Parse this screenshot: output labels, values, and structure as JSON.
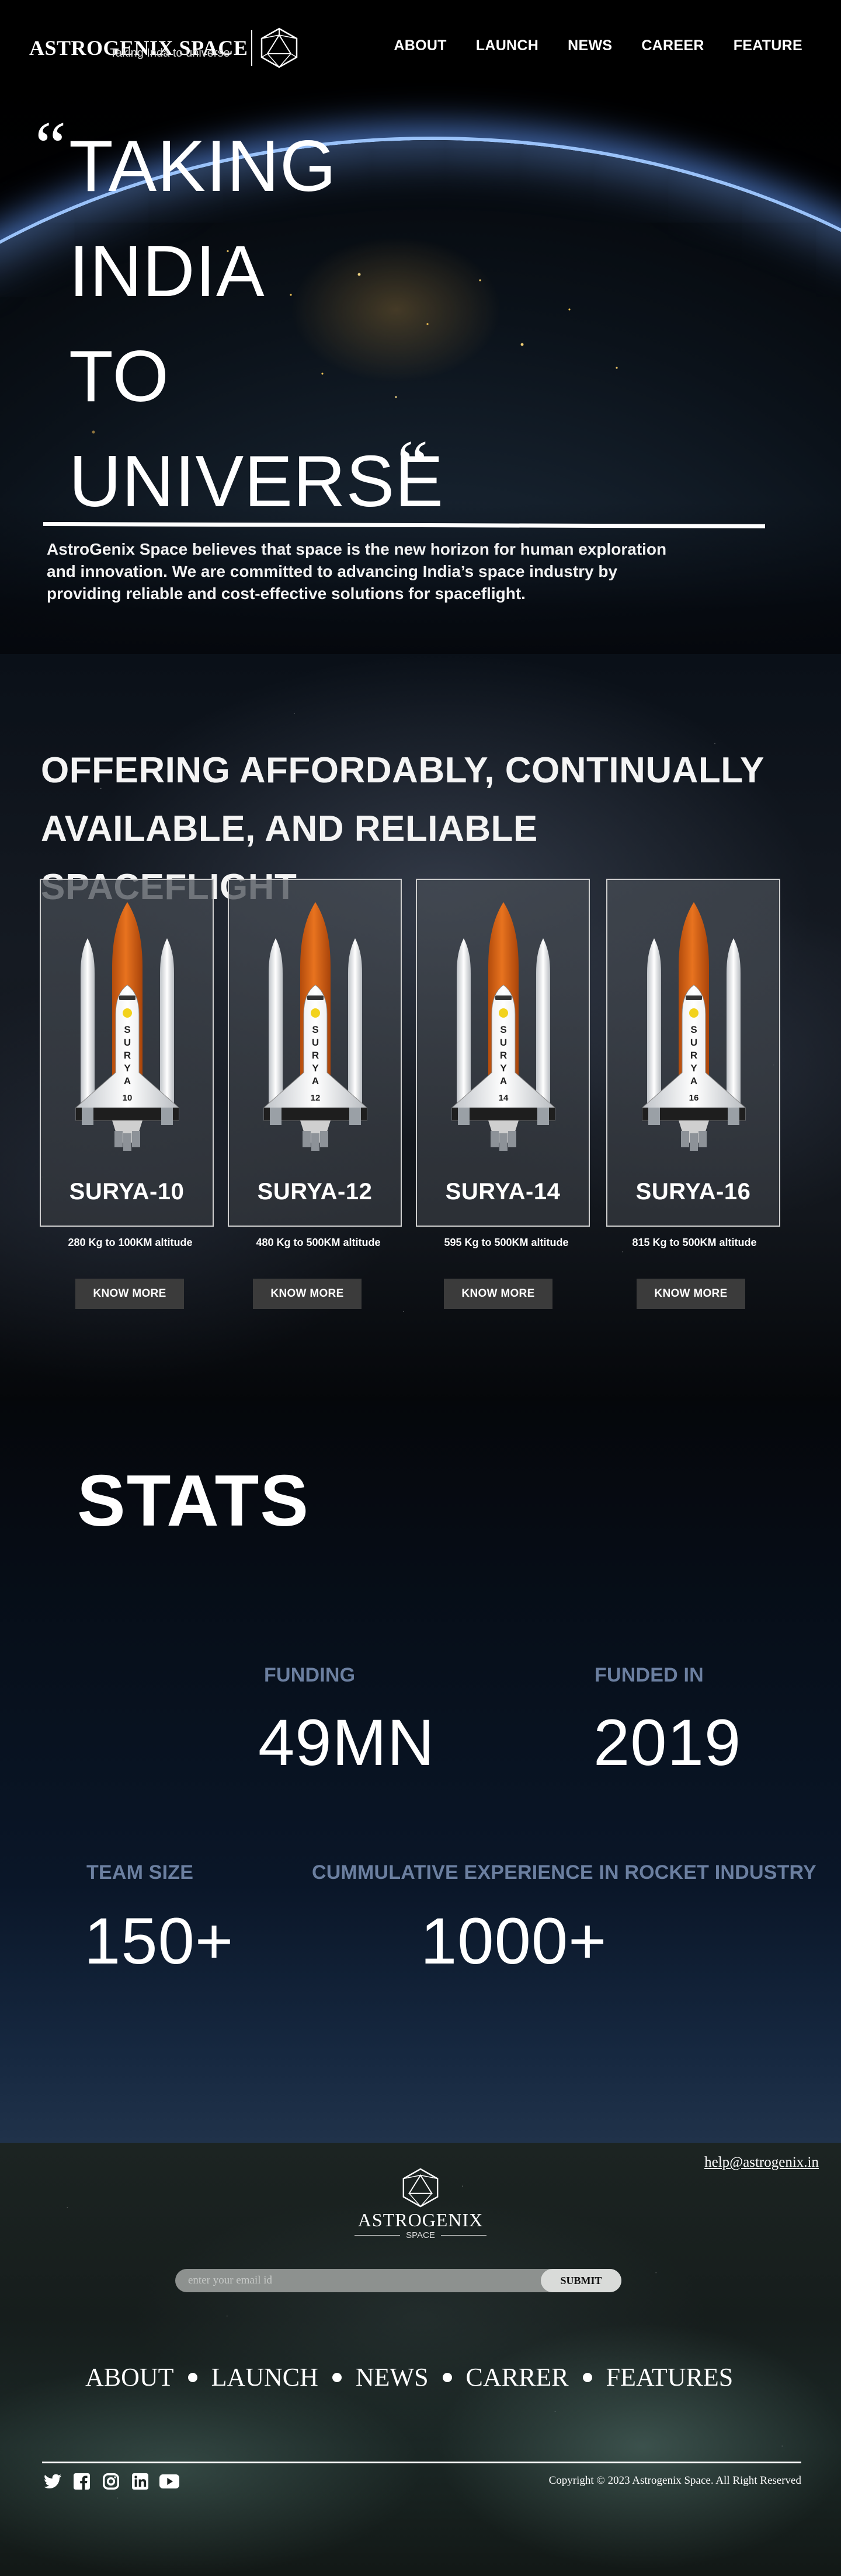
{
  "brand": {
    "name": "ASTROGENIX SPACE",
    "tagline": "Taking Inda to universe"
  },
  "nav": {
    "items": [
      {
        "label": "ABOUT"
      },
      {
        "label": "LAUNCH"
      },
      {
        "label": "NEWS"
      },
      {
        "label": "CAREER"
      },
      {
        "label": "FEATURE"
      }
    ]
  },
  "hero": {
    "quote_open": "“",
    "quote_close": "“",
    "lines": [
      "TAKING",
      "INDIA",
      "TO",
      "UNIVERSE"
    ],
    "description": "AstroGenix Space believes that space is the new horizon for human exploration and innovation. We are committed to advancing India’s space industry by providing reliable and cost-effective solutions for spaceflight."
  },
  "offering": {
    "title_line1": "OFFERING AFFORDABLY, CONTINUALLY",
    "title_line2": "AVAILABLE, AND RELIABLE SPACEFLIGHT",
    "rockets": [
      {
        "name": "SURYA-10",
        "number": "10",
        "spec": "280 Kg  to 100KM altitude",
        "button": "KNOW MORE"
      },
      {
        "name": "SURYA-12",
        "number": "12",
        "spec": "480 Kg  to 500KM altitude",
        "button": "KNOW MORE"
      },
      {
        "name": "SURYA-14",
        "number": "14",
        "spec": "595 Kg  to 500KM altitude",
        "button": "KNOW MORE"
      },
      {
        "name": "SURYA-16",
        "number": "16",
        "spec": "815 Kg  to 500KM altitude",
        "button": "KNOW MORE"
      }
    ],
    "rocket_body_text": "SURYA"
  },
  "stats": {
    "title": "STATS",
    "items": [
      {
        "label": "FUNDING",
        "value": "49MN"
      },
      {
        "label": "FUNDED IN",
        "value": "2019"
      },
      {
        "label": "TEAM SIZE",
        "value": "150+"
      },
      {
        "label": "CUMMULATIVE EXPERIENCE IN ROCKET INDUSTRY",
        "value": "1000+"
      }
    ]
  },
  "footer": {
    "email": "help@astrogenix.in",
    "logo_name": "ASTROGENIX",
    "logo_sub": "SPACE",
    "subscribe_placeholder": "enter your email id",
    "subscribe_button": "SUBMIT",
    "nav": [
      {
        "label": "ABOUT"
      },
      {
        "label": "LAUNCH"
      },
      {
        "label": "NEWS"
      },
      {
        "label": "CARRER"
      },
      {
        "label": "FEATURES"
      }
    ],
    "socials": [
      {
        "icon": "twitter-icon"
      },
      {
        "icon": "facebook-icon"
      },
      {
        "icon": "instagram-icon"
      },
      {
        "icon": "linkedin-icon"
      },
      {
        "icon": "youtube-icon"
      }
    ],
    "copyright": "Copyright © 2023 Astrogenix Space. All Right Reserved"
  },
  "colors": {
    "stat_label": "#6b7fa0",
    "rocket_orange": "#e8731f",
    "button_bg": "#3b3b3b"
  }
}
